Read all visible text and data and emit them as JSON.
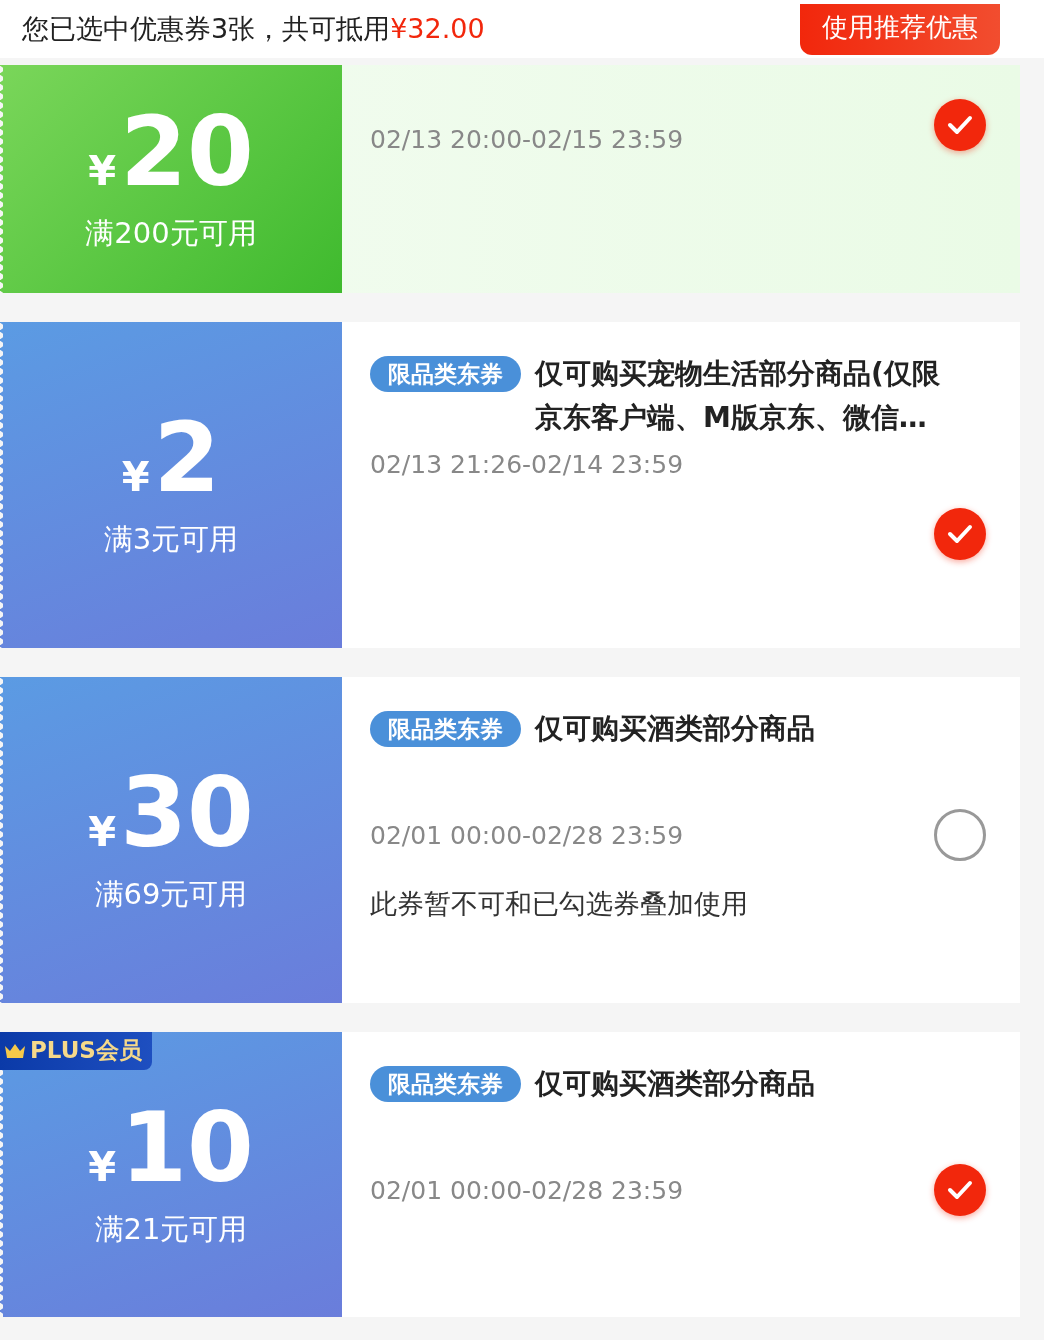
{
  "summary": {
    "text": "您已选中优惠券3张，共可抵用",
    "amount": "¥32.00",
    "button": "使用推荐优惠"
  },
  "coupons": [
    {
      "kind": "green",
      "currency": "¥",
      "amount": "20",
      "condition": "满200元可用",
      "period": "02/13 20:00-02/15 23:59",
      "selected": true
    },
    {
      "kind": "blue",
      "currency": "¥",
      "amount": "2",
      "condition": "满3元可用",
      "tag": "限品类东券",
      "description": "仅可购买宠物生活部分商品(仅限京东客户端、M版京东、微信…",
      "period": "02/13 21:26-02/14 23:59",
      "selected": true
    },
    {
      "kind": "blue",
      "currency": "¥",
      "amount": "30",
      "condition": "满69元可用",
      "tag": "限品类东券",
      "description": "仅可购买酒类部分商品",
      "period": "02/01 00:00-02/28 23:59",
      "note": "此券暂不可和已勾选券叠加使用",
      "selected": false
    },
    {
      "kind": "blue",
      "badge": "PLUS会员",
      "currency": "¥",
      "amount": "10",
      "condition": "满21元可用",
      "tag": "限品类东券",
      "description": "仅可购买酒类部分商品",
      "period": "02/01 00:00-02/28 23:59",
      "selected": true
    }
  ]
}
